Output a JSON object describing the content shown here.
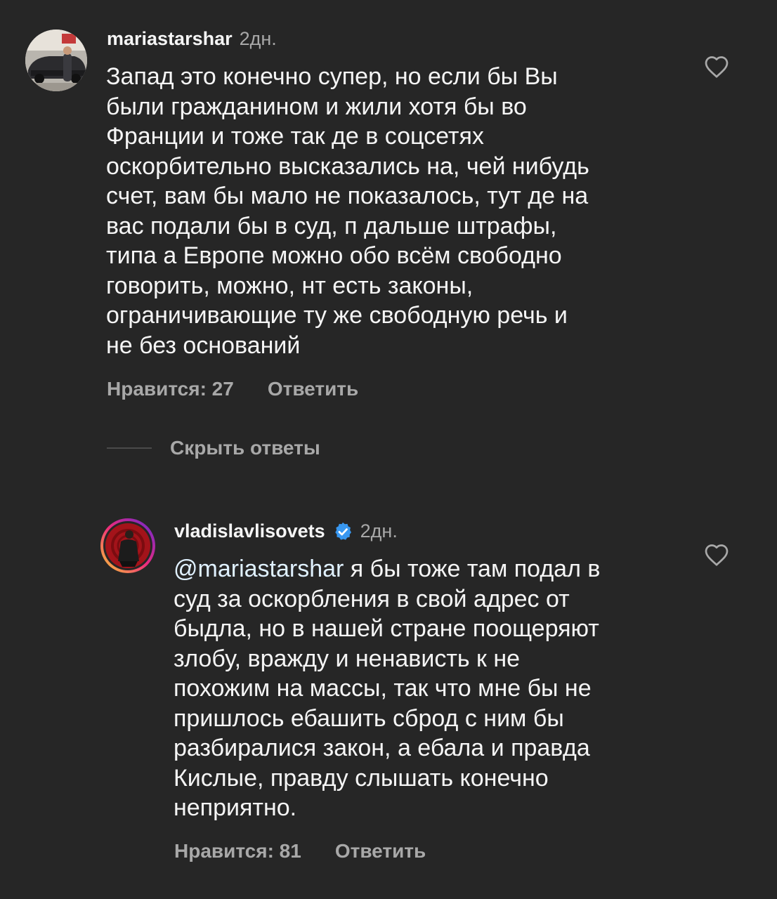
{
  "comments": [
    {
      "username": "mariastarshar",
      "time": "2дн.",
      "text": "Запад это конечно супер, но если бы Вы\nбыли гражданином и жили хотя бы во\nФранции и тоже так де в соцсетях\nоскорбительно высказались на, чей нибудь\nсчет, вам бы мало не показалось, тут де на\nвас подали бы в суд, п дальше штрафы,\nтипа а Европе можно обо всём свободно\nговорить, можно, нт есть законы,\nограничивающие ту же свободную речь и\nне без оснований",
      "likes_label": "Нравится: 27",
      "reply_label": "Ответить",
      "avatar_icon": "user-photo-avatar",
      "like_icon": "heart-outline-icon"
    },
    {
      "username": "vladislavlisovets",
      "verified": true,
      "time": "2дн.",
      "mention": "@mariastarshar",
      "text": " я бы тоже там подал в\nсуд за оскорбления в свой адрес от\nбыдла, но в нашей стране поощеряют\nзлобу, вражду и ненависть к не\nпохожим на массы, так что мне бы не\nпришлось ебашить сброд с ним бы\nразбиралися закон, а ебала и правда\nКислые, правду слышать конечно\nнеприятно.",
      "likes_label": "Нравится: 81",
      "reply_label": "Ответить",
      "avatar_icon": "user-photo-avatar-story-ring",
      "like_icon": "heart-outline-icon"
    }
  ],
  "hide_replies_label": "Скрыть ответы",
  "colors": {
    "background": "#262626",
    "text": "#f5f5f5",
    "secondary": "#a8a8a8",
    "verified": "#3897f0",
    "mention": "#e0f1ff"
  }
}
